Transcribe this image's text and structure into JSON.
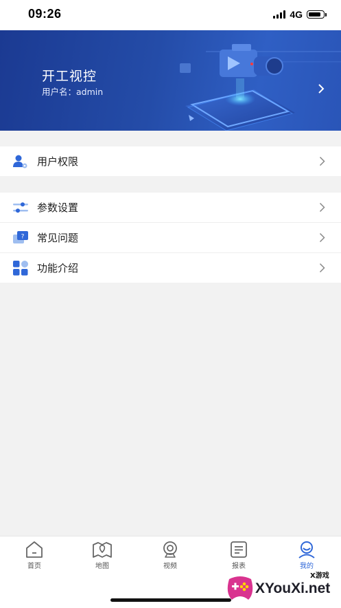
{
  "status_bar": {
    "time": "09:26",
    "network": "4G"
  },
  "banner": {
    "title": "开工视控",
    "user_label": "用户名：admin"
  },
  "menu": {
    "group1": [
      {
        "label": "用户权限",
        "icon": "user-settings-icon"
      }
    ],
    "group2": [
      {
        "label": "参数设置",
        "icon": "sliders-icon"
      },
      {
        "label": "常见问题",
        "icon": "help-chat-icon"
      },
      {
        "label": "功能介绍",
        "icon": "grid-apps-icon"
      }
    ]
  },
  "tabbar": {
    "items": [
      {
        "label": "首页",
        "icon": "home-icon"
      },
      {
        "label": "地图",
        "icon": "map-icon"
      },
      {
        "label": "视频",
        "icon": "camera-icon"
      },
      {
        "label": "报表",
        "icon": "report-icon"
      },
      {
        "label": "我的",
        "icon": "profile-icon",
        "active": true
      }
    ]
  },
  "watermark": {
    "small": "X游戏",
    "text": "XYouXi.net"
  },
  "colors": {
    "accent": "#2f67d8",
    "banner": "#244ca8",
    "background": "#f2f2f2"
  }
}
